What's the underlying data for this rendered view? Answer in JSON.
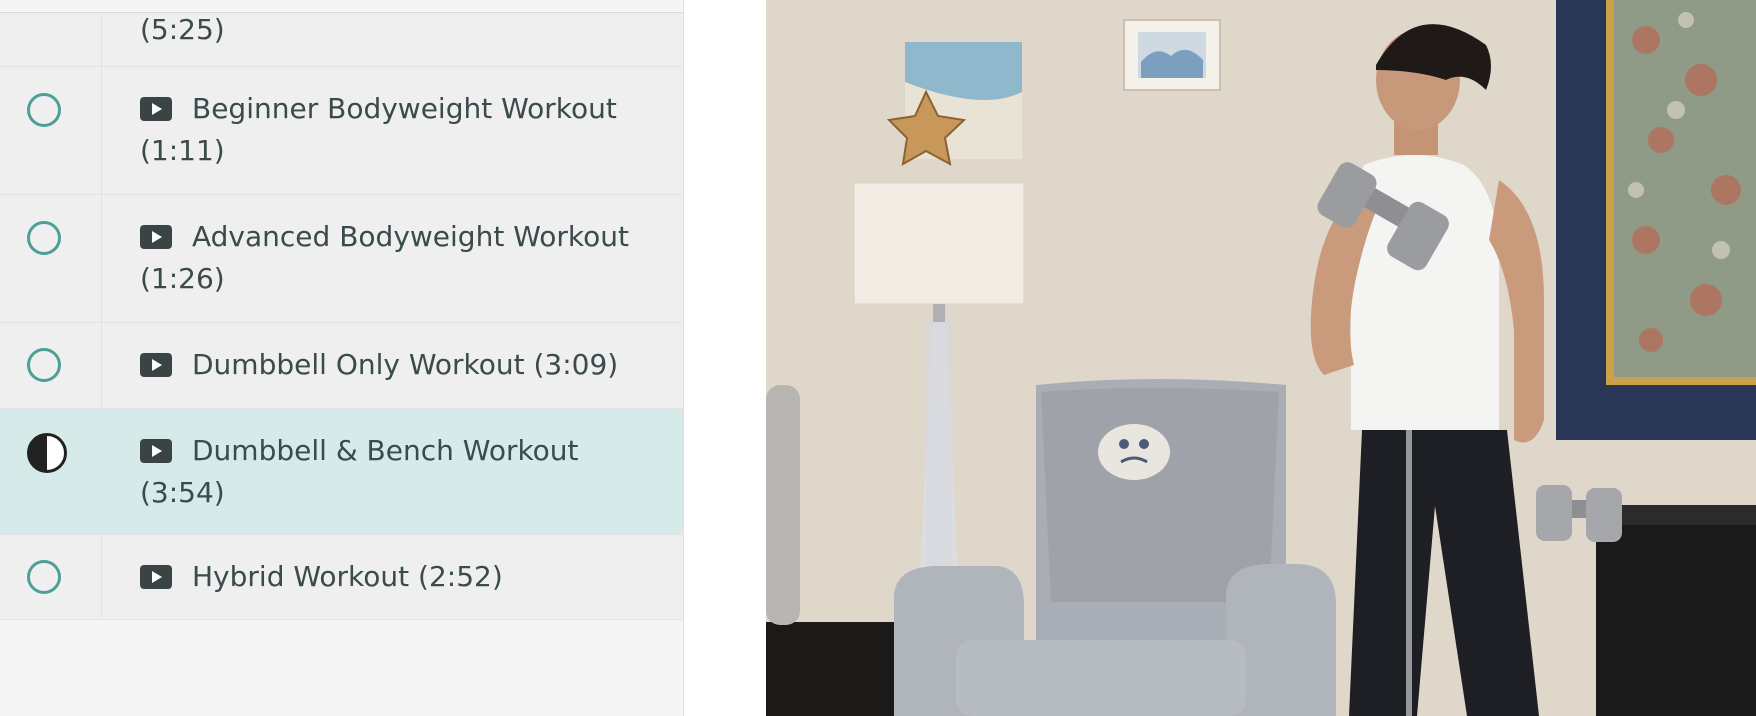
{
  "lessons": [
    {
      "title": "(5:25)",
      "status": "incomplete"
    },
    {
      "title": "Beginner Bodyweight Workout",
      "duration": "(1:11)",
      "status": "incomplete"
    },
    {
      "title": "Advanced Bodyweight Workout",
      "duration": "(1:26)",
      "status": "incomplete"
    },
    {
      "title": "Dumbbell Only Workout (3:09)",
      "status": "incomplete"
    },
    {
      "title": "Dumbbell & Bench Workout",
      "duration": "(3:54)",
      "status": "in-progress"
    },
    {
      "title": "Hybrid Workout (2:52)",
      "status": "incomplete"
    }
  ],
  "icons": {
    "play": "play-video-icon",
    "incomplete": "circle-outline-icon",
    "in_progress": "half-circle-icon"
  },
  "colors": {
    "accent": "#4d9f98",
    "active_row": "#d7eaea",
    "text": "#3b4a4b"
  }
}
